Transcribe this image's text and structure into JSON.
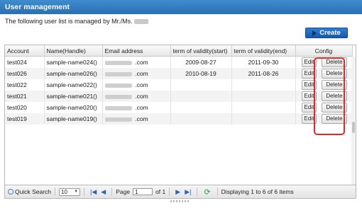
{
  "header": {
    "title": "User management"
  },
  "subtitle": "The following user list is managed by Mr./Ms.",
  "create_label": "Create",
  "table": {
    "columns": [
      "Account",
      "Name(Handle)",
      "Email address",
      "term of validity(start)",
      "term of validity(end)",
      "Config"
    ],
    "rows": [
      {
        "account": "test024",
        "name": "sample-name024()",
        "email_suffix": ".com",
        "start": "2009-08-27",
        "end": "2011-09-30"
      },
      {
        "account": "test026",
        "name": "sample-name026()",
        "email_suffix": ".com",
        "start": "2010-08-19",
        "end": "2011-08-26"
      },
      {
        "account": "test022",
        "name": "sample-name022()",
        "email_suffix": ".com",
        "start": "",
        "end": ""
      },
      {
        "account": "test021",
        "name": "sample-name021()",
        "email_suffix": ".com",
        "start": "",
        "end": ""
      },
      {
        "account": "test020",
        "name": "sample-name020()",
        "email_suffix": ".com",
        "start": "",
        "end": ""
      },
      {
        "account": "test019",
        "name": "sample-name019()",
        "email_suffix": ".com",
        "start": "",
        "end": ""
      }
    ],
    "edit_label": "Edit",
    "delete_label": "Delete"
  },
  "pager": {
    "quick_search": "Quick Search",
    "per_page": "10",
    "page_label": "Page",
    "page_value": "1",
    "of_label": "of 1",
    "display_text": "Displaying 1 to 6 of 6 items"
  },
  "icons": [
    "create-arrow-icon",
    "quick-search-icon",
    "first-page-icon",
    "prev-page-icon",
    "next-page-icon",
    "last-page-icon",
    "refresh-icon"
  ],
  "colors": {
    "title_bar": "#2a6fb3",
    "create_button": "#1f6cc6",
    "highlight_box": "#e02a2a"
  }
}
